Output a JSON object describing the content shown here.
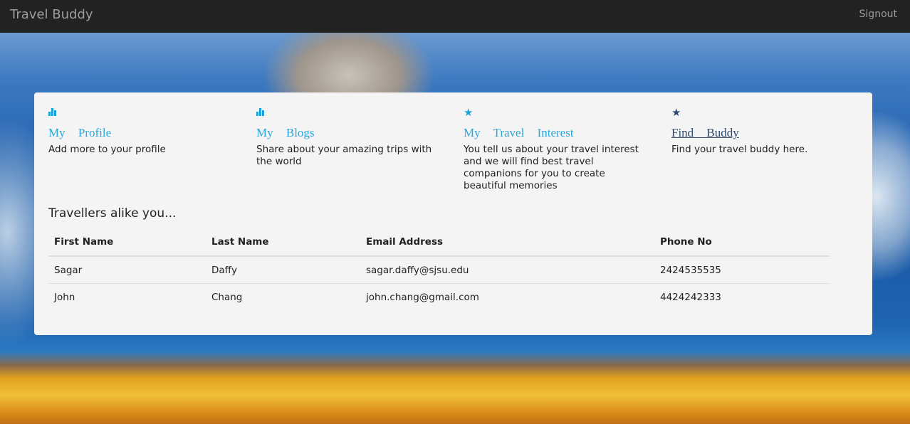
{
  "nav": {
    "brand": "Travel Buddy",
    "signout_label": "Signout"
  },
  "cards": [
    {
      "icon": "bar-chart-icon",
      "title": "My Profile",
      "description": "Add more to your profile"
    },
    {
      "icon": "bar-chart-icon",
      "title": "My Blogs",
      "description": "Share about your amazing trips with the world"
    },
    {
      "icon": "star-icon",
      "title": "My Travel Interest",
      "description": "You tell us about your travel interest and we will find best travel companions for you to create beautiful memories"
    },
    {
      "icon": "star-icon",
      "title": "Find Buddy",
      "description": "Find your travel buddy here."
    }
  ],
  "travellers": {
    "heading": "Travellers alike you...",
    "columns": [
      "First Name",
      "Last Name",
      "Email Address",
      "Phone No"
    ],
    "rows": [
      [
        "Sagar",
        "Daffy",
        "sagar.daffy@sjsu.edu",
        "2424535535"
      ],
      [
        "John",
        "Chang",
        "john.chang@gmail.com",
        "4424242333"
      ]
    ]
  },
  "colors": {
    "accent": "#2aa6d9",
    "link_dark": "#2a4a6e",
    "navbar": "#222222",
    "panel": "#f4f4f4"
  }
}
